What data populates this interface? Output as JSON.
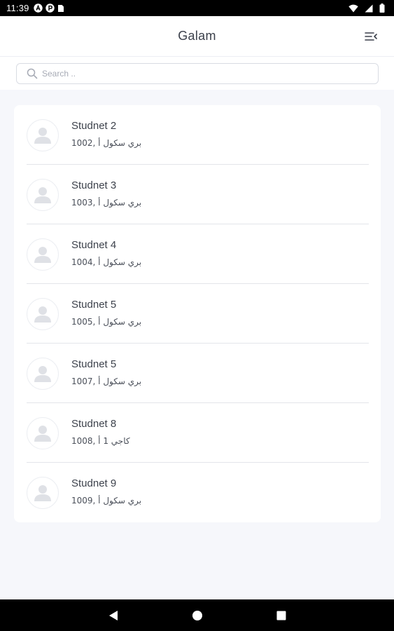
{
  "status_bar": {
    "time": "11:39",
    "left_icons": [
      "notification-a-icon",
      "notification-p-icon",
      "sim-card-icon"
    ],
    "right_icons": [
      "wifi-icon",
      "signal-icon",
      "battery-icon"
    ]
  },
  "header": {
    "title": "Galam",
    "menu_icon": "menu-collapse-icon"
  },
  "search": {
    "placeholder": "Search .."
  },
  "students": [
    {
      "name": "Studnet 2",
      "detail": "1002, بري سكول أ"
    },
    {
      "name": "Studnet 3",
      "detail": "1003, بري سكول أ"
    },
    {
      "name": "Studnet 4",
      "detail": "1004, بري سكول أ"
    },
    {
      "name": "Studnet 5",
      "detail": "1005, بري سكول أ"
    },
    {
      "name": "Studnet 5",
      "detail": "1007, بري سكول أ"
    },
    {
      "name": "Studnet 8",
      "detail": "1008, كاجي 1 أ"
    },
    {
      "name": "Studnet 9",
      "detail": "1009, بري سكول أ"
    }
  ],
  "nav_bar": {
    "buttons": [
      "back-icon",
      "home-icon",
      "recents-icon"
    ]
  },
  "colors": {
    "background": "#f6f7fb",
    "card": "#ffffff",
    "title_text": "#3a3f4a",
    "divider": "#e3e5ea",
    "avatar_silhouette": "#dfe1e6"
  }
}
